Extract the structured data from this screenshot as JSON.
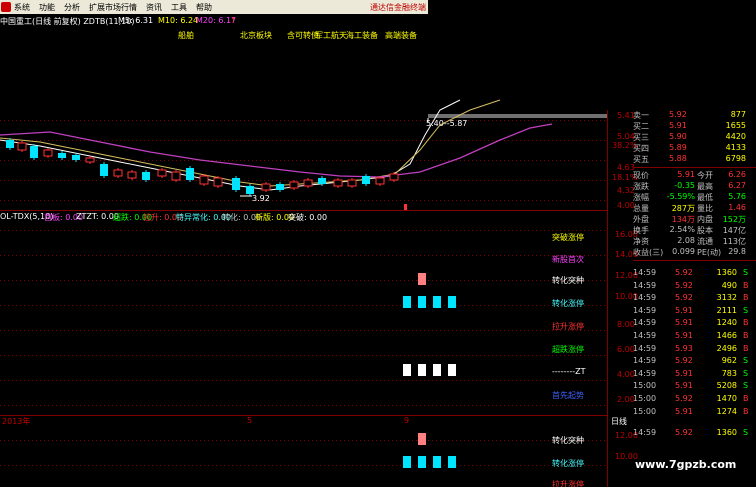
{
  "menu": {
    "items": [
      "系统",
      "功能",
      "分析",
      "扩展市场行情",
      "资讯",
      "工具",
      "帮助"
    ],
    "right_text": "通达信金融终端"
  },
  "header": {
    "stock": "中国重工(日线 前复权) ZDTB(11,10)",
    "ma5": "M5: 6.31",
    "ma10": "M10: 6.24",
    "ma20": "M20: 6.17"
  },
  "sectors": [
    "船舶",
    "北京板块",
    "含可转债",
    "军工航天",
    "海工装备",
    "高端装备"
  ],
  "chart": {
    "price_callout": "5.40--5.87",
    "low_mark": "3.92",
    "price_axis": [
      "5.41",
      "5.04",
      "38.2%",
      "4.63",
      "18.1%",
      "4.32",
      "4.00"
    ],
    "indicator_header": {
      "name": "OL-TDX(5,10)",
      "items": [
        "首板: 0.00",
        "ZTZT: 0.00",
        "超跌: 0.00",
        "拉升: 0.00",
        "特异常化: 0.00",
        "转化: 0.00",
        "新版: 0.00",
        "突破: 0.00"
      ]
    },
    "indicator_labels": [
      "突破涨停",
      "新股首次",
      "转化突种",
      "转化涨停",
      "拉升涨停",
      "超跌涨停",
      "--------ZT",
      "首先起势"
    ],
    "indicator_axis": [
      "16.00",
      "14.00",
      "12.00",
      "10.00",
      "8.00",
      "6.00",
      "4.00",
      "2.00"
    ],
    "date_labels": [
      "2013年",
      "5",
      "9"
    ],
    "lower_labels": [
      "转化突种",
      "转化涨停",
      "拉升涨停"
    ],
    "lower_axis": [
      "12.00",
      "10.00"
    ],
    "tab_label": "日线"
  },
  "quote": {
    "book": [
      {
        "label": "卖一",
        "price": "5.92",
        "vol": "877"
      },
      {
        "label": "买二",
        "price": "5.91",
        "vol": "1655"
      },
      {
        "label": "买三",
        "price": "5.90",
        "vol": "4420"
      },
      {
        "label": "买四",
        "price": "5.89",
        "vol": "4133"
      },
      {
        "label": "买五",
        "price": "5.88",
        "vol": "6798"
      }
    ],
    "stats": [
      {
        "l1": "现价",
        "v1": "5.91",
        "l2": "今开",
        "v2": "6.26"
      },
      {
        "l1": "涨跌",
        "v1": "-0.35",
        "l2": "最高",
        "v2": "6.27"
      },
      {
        "l1": "涨幅",
        "v1": "-5.59%",
        "l2": "最低",
        "v2": "5.76"
      },
      {
        "l1": "总量",
        "v1": "287万",
        "l2": "量比",
        "v2": "1.46"
      },
      {
        "l1": "外盘",
        "v1": "134万",
        "l2": "内盘",
        "v2": "152万"
      },
      {
        "l1": "换手",
        "v1": "2.54%",
        "l2": "股本",
        "v2": "147亿"
      },
      {
        "l1": "净资",
        "v1": "2.08",
        "l2": "流通",
        "v2": "113亿"
      },
      {
        "l1": "收益(三)",
        "v1": "0.099",
        "l2": "PE(动)",
        "v2": "29.8"
      }
    ],
    "ticks": [
      {
        "time": "14:59",
        "price": "5.92",
        "vol": "1360",
        "side": "S"
      },
      {
        "time": "14:59",
        "price": "5.92",
        "vol": "490",
        "side": "B"
      },
      {
        "time": "14:59",
        "price": "5.92",
        "vol": "3132",
        "side": "B"
      },
      {
        "time": "14:59",
        "price": "5.91",
        "vol": "2111",
        "side": "S"
      },
      {
        "time": "14:59",
        "price": "5.91",
        "vol": "1240",
        "side": "B"
      },
      {
        "time": "14:59",
        "price": "5.91",
        "vol": "1466",
        "side": "B"
      },
      {
        "time": "14:59",
        "price": "5.93",
        "vol": "2496",
        "side": "B"
      },
      {
        "time": "14:59",
        "price": "5.92",
        "vol": "962",
        "side": "S"
      },
      {
        "time": "14:59",
        "price": "5.91",
        "vol": "783",
        "side": "S"
      },
      {
        "time": "15:00",
        "price": "5.91",
        "vol": "5208",
        "side": "S"
      },
      {
        "time": "15:00",
        "price": "5.92",
        "vol": "1470",
        "side": "B"
      },
      {
        "time": "15:00",
        "price": "5.91",
        "vol": "1274",
        "side": "B"
      },
      {
        "time": "14:59",
        "price": "5.92",
        "vol": "1360",
        "side": "S"
      }
    ]
  },
  "watermark": "www.7gpzb.com",
  "colors": {
    "up": "#ff3333",
    "down": "#00e5ff",
    "grid": "#800000",
    "ma_white": "#ffffff",
    "ma_yellow": "#d8c060",
    "ma_magenta": "#c040c0"
  }
}
